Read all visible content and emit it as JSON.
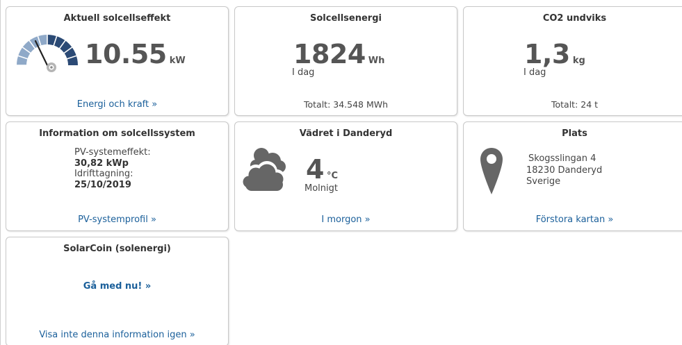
{
  "tiles": {
    "power": {
      "title": "Aktuell solcellseffekt",
      "value": "10.55",
      "unit": "kW",
      "link": "Energi och kraft »",
      "gauge_icon": "gauge-icon"
    },
    "energy": {
      "title": "Solcellsenergi",
      "value": "1824",
      "unit": "Wh",
      "period": "I dag",
      "total": "Totalt: 34.548 MWh"
    },
    "co2": {
      "title": "CO2 undviks",
      "value": "1,3",
      "unit": "kg",
      "period": "I dag",
      "total": "Totalt: 24 t"
    },
    "system_info": {
      "title": "Information om solcellssystem",
      "power_label": "PV-systemeffekt:",
      "power_value": "30,82 kWp",
      "commission_label": "Idrifttagning:",
      "commission_value": "25/10/2019",
      "link": "PV-systemprofil »"
    },
    "weather": {
      "title": "Vädret i Danderyd",
      "temperature": "4",
      "unit": "°C",
      "condition": "Molnigt",
      "link": "I morgon »",
      "icon": "cloud-icon"
    },
    "location": {
      "title": "Plats",
      "street": "Skogsslingan 4",
      "postal": "18230 Danderyd",
      "country": "Sverige",
      "link": "Förstora kartan »",
      "icon": "map-pin-icon"
    },
    "solarcoin": {
      "title": "SolarCoin (solenergi)",
      "join_link": "Gå med nu! »",
      "dismiss_link": "Visa inte denna information igen »"
    }
  },
  "colors": {
    "link": "#1a5f9a",
    "gauge_dark": "#2b4a75",
    "gauge_light": "#a8bfd8",
    "icon_gray": "#666666"
  }
}
